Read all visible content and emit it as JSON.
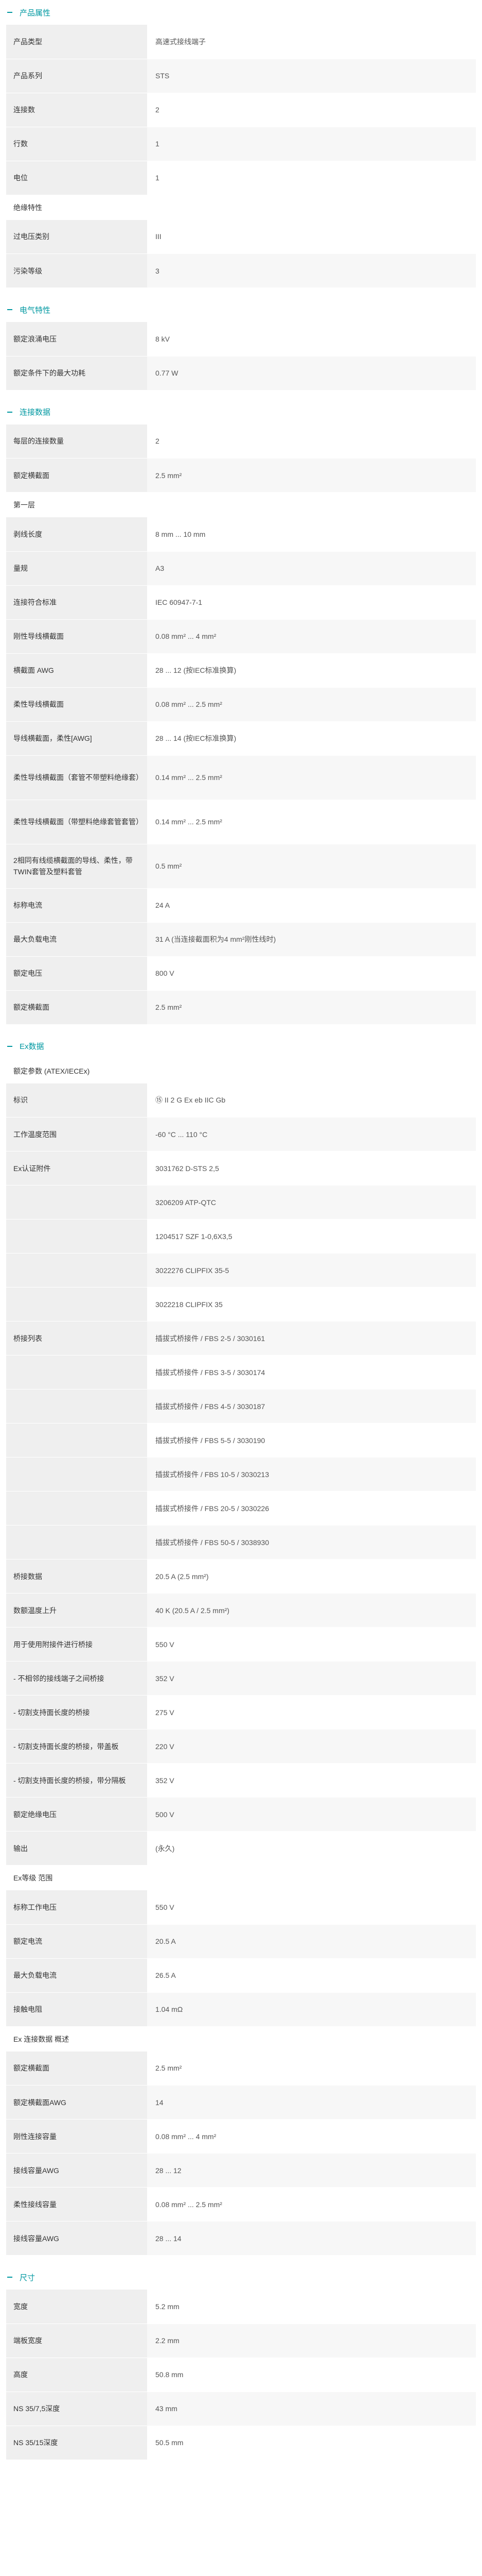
{
  "sections": {
    "product": {
      "title": "产品属性",
      "rows": [
        {
          "k": "产品类型",
          "v": "高速式接线端子"
        },
        {
          "k": "产品系列",
          "v": "STS"
        },
        {
          "k": "连接数",
          "v": "2"
        },
        {
          "k": "行数",
          "v": "1"
        },
        {
          "k": "电位",
          "v": "1"
        }
      ],
      "insulation_title": "绝缘特性",
      "insulation_rows": [
        {
          "k": "过电压类别",
          "v": "III"
        },
        {
          "k": "污染等级",
          "v": "3"
        }
      ]
    },
    "electrical": {
      "title": "电气特性",
      "rows": [
        {
          "k": "额定浪涌电压",
          "v": "8 kV"
        },
        {
          "k": "额定条件下的最大功耗",
          "v": "0.77 W"
        }
      ]
    },
    "connection": {
      "title": "连接数据",
      "rows": [
        {
          "k": "每层的连接数量",
          "v": "2"
        },
        {
          "k": "额定横截面",
          "v": "2.5 mm²"
        }
      ],
      "level1_title": "第一层",
      "level1_rows": [
        {
          "k": "剥线长度",
          "v": "8 mm ... 10 mm"
        },
        {
          "k": "量规",
          "v": "A3"
        },
        {
          "k": "连接符合标准",
          "v": "IEC 60947-7-1"
        },
        {
          "k": "刚性导线横截面",
          "v": "0.08 mm² ... 4 mm²"
        },
        {
          "k": "横截面 AWG",
          "v": "28 ... 12 (按IEC标准换算)"
        },
        {
          "k": "柔性导线横截面",
          "v": "0.08 mm² ... 2.5 mm²"
        },
        {
          "k": "导线横截面，柔性[AWG]",
          "v": "28 ... 14 (按IEC标准换算)"
        },
        {
          "k": "柔性导线横截面（套管不带塑料绝缘套）",
          "v": "0.14 mm² ... 2.5 mm²",
          "tall": true
        },
        {
          "k": "柔性导线横截面（带塑料绝缘套管套管）",
          "v": "0.14 mm² ... 2.5 mm²",
          "tall": true
        },
        {
          "k": "2相同有线缆横截面的导线、柔性，带TWIN套管及塑料套管",
          "v": "0.5 mm²",
          "tall": true
        },
        {
          "k": "标称电流",
          "v": "24 A"
        },
        {
          "k": "最大负载电流",
          "v": "31 A (当连接截面积为4 mm²刚性线时)"
        },
        {
          "k": "额定电压",
          "v": "800 V"
        },
        {
          "k": "额定横截面",
          "v": "2.5 mm²"
        }
      ]
    },
    "ex": {
      "title": "Ex数据",
      "params_title": "额定参数 (ATEX/IECEx)",
      "rows": [
        {
          "k": "标识",
          "v": "⑮ II 2 G  Ex eb IIC Gb"
        },
        {
          "k": "工作温度范围",
          "v": "-60 °C ... 110 °C"
        },
        {
          "k": "Ex认证附件",
          "v": "3031762 D-STS 2,5"
        },
        {
          "k": "",
          "v": "3206209 ATP-QTC"
        },
        {
          "k": "",
          "v": "1204517 SZF 1-0,6X3,5"
        },
        {
          "k": "",
          "v": "3022276 CLIPFIX 35-5"
        },
        {
          "k": "",
          "v": "3022218 CLIPFIX 35"
        },
        {
          "k": "桥接列表",
          "v": "插拔式桥接件 / FBS 2-5 / 3030161"
        },
        {
          "k": "",
          "v": "插拔式桥接件 / FBS 3-5 / 3030174"
        },
        {
          "k": "",
          "v": "插拔式桥接件 / FBS 4-5 / 3030187"
        },
        {
          "k": "",
          "v": "插拔式桥接件 / FBS 5-5 / 3030190"
        },
        {
          "k": "",
          "v": "插拔式桥接件 / FBS 10-5 / 3030213"
        },
        {
          "k": "",
          "v": "插拔式桥接件 / FBS 20-5 / 3030226"
        },
        {
          "k": "",
          "v": "插拔式桥接件 / FBS 50-5 / 3038930"
        },
        {
          "k": "桥接数据",
          "v": "20.5 A (2.5 mm²)"
        },
        {
          "k": "数额温度上升",
          "v": "40 K (20.5 A / 2.5 mm²)"
        },
        {
          "k": "用于使用附接件进行桥接",
          "v": "550 V"
        },
        {
          "k": "- 不相邻的接线端子之间桥接",
          "v": "352 V"
        },
        {
          "k": "- 切割支持面长度的桥接",
          "v": "275 V"
        },
        {
          "k": "- 切割支持面长度的桥接，带盖板",
          "v": "220 V"
        },
        {
          "k": "- 切割支持面长度的桥接，带分隔板",
          "v": "352 V"
        },
        {
          "k": "额定绝缘电压",
          "v": "500 V"
        },
        {
          "k": "输出",
          "v": "(永久)"
        }
      ],
      "terminal_title": "Ex等级 范围",
      "terminal_rows": [
        {
          "k": "标称工作电压",
          "v": "550 V"
        },
        {
          "k": "额定电流",
          "v": "20.5 A"
        },
        {
          "k": "最大负载电流",
          "v": "26.5 A"
        },
        {
          "k": "接触电阻",
          "v": "1.04 mΩ"
        }
      ],
      "conn_title": "Ex 连接数据 概述",
      "conn_rows": [
        {
          "k": "额定横截面",
          "v": "2.5 mm²"
        },
        {
          "k": "额定横截面AWG",
          "v": "14"
        },
        {
          "k": "刚性连接容量",
          "v": "0.08 mm² ... 4 mm²"
        },
        {
          "k": "接线容量AWG",
          "v": "28 ... 12"
        },
        {
          "k": "柔性接线容量",
          "v": "0.08 mm² ... 2.5 mm²"
        },
        {
          "k": "接线容量AWG",
          "v": "28 ... 14"
        }
      ]
    },
    "dimensions": {
      "title": "尺寸",
      "rows": [
        {
          "k": "宽度",
          "v": "5.2 mm"
        },
        {
          "k": "端板宽度",
          "v": "2.2 mm"
        },
        {
          "k": "高度",
          "v": "50.8 mm"
        },
        {
          "k": "NS 35/7,5深度",
          "v": "43 mm"
        },
        {
          "k": "NS 35/15深度",
          "v": "50.5 mm"
        }
      ]
    }
  },
  "colors": {
    "accent": "#0098a1",
    "label_bg": "#efefef",
    "alt_bg": "#f7f7f7"
  }
}
